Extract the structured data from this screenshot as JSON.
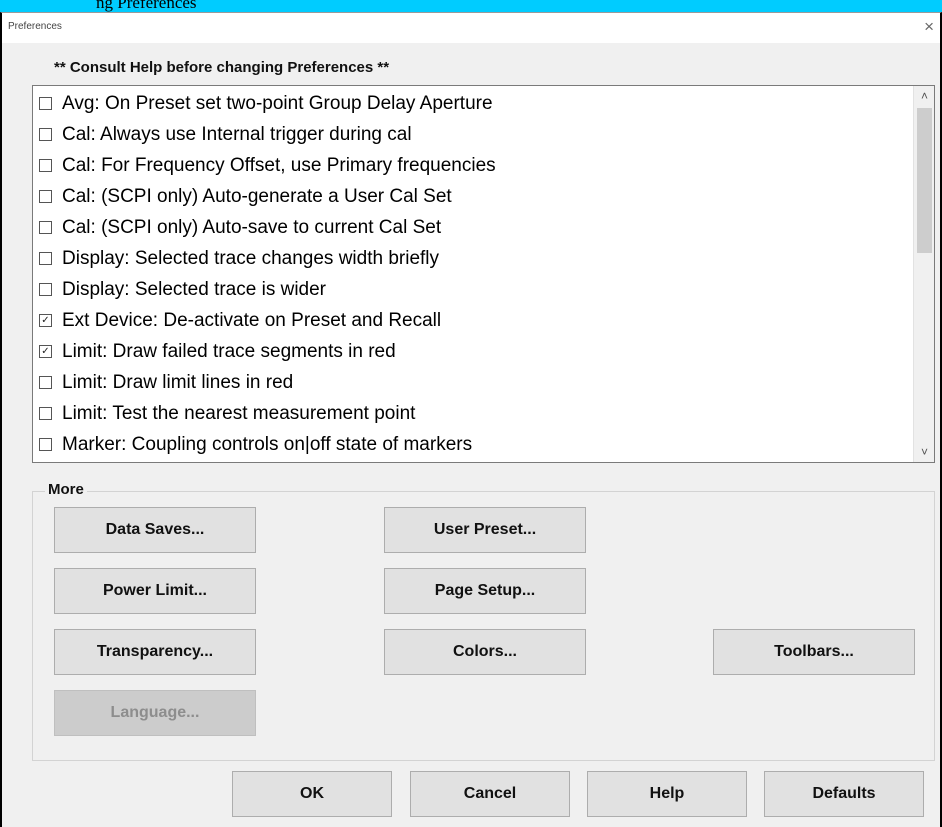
{
  "header": {
    "cut_text": "ng Preferences"
  },
  "dialog": {
    "title": "Preferences",
    "close": "×",
    "notice": "** Consult Help before changing Preferences **"
  },
  "preferences": {
    "items": [
      {
        "label": "Avg: On Preset set two-point Group Delay Aperture",
        "checked": false,
        "mark": ""
      },
      {
        "label": "Cal: Always use Internal trigger during cal",
        "checked": false,
        "mark": ""
      },
      {
        "label": "Cal: For Frequency Offset, use Primary frequencies",
        "checked": false,
        "mark": ""
      },
      {
        "label": "Cal: (SCPI only) Auto-generate a User Cal Set",
        "checked": false,
        "mark": ""
      },
      {
        "label": "Cal: (SCPI only) Auto-save to current Cal Set",
        "checked": false,
        "mark": ""
      },
      {
        "label": "Display: Selected trace changes width briefly",
        "checked": false,
        "mark": ""
      },
      {
        "label": "Display: Selected trace is wider",
        "checked": false,
        "mark": ""
      },
      {
        "label": "Ext Device: De-activate on Preset and Recall",
        "checked": true,
        "mark": "✓"
      },
      {
        "label": "Limit: Draw failed trace segments in red",
        "checked": true,
        "mark": "✓"
      },
      {
        "label": "Limit: Draw limit lines in red",
        "checked": false,
        "mark": ""
      },
      {
        "label": "Limit: Test the nearest measurement point",
        "checked": false,
        "mark": ""
      },
      {
        "label": "Marker: Coupling controls on|off state of markers",
        "checked": false,
        "mark": ""
      }
    ],
    "scroll_up": "˄",
    "scroll_down": "˅"
  },
  "more": {
    "legend": "More",
    "buttons": {
      "data_saves": "Data Saves...",
      "user_preset": "User Preset...",
      "power_limit": "Power Limit...",
      "page_setup": "Page Setup...",
      "transparency": "Transparency...",
      "colors": "Colors...",
      "toolbars": "Toolbars...",
      "language": "Language..."
    }
  },
  "footer": {
    "ok": "OK",
    "cancel": "Cancel",
    "help": "Help",
    "defaults": "Defaults"
  },
  "colors": {
    "top_band": "#00ccff",
    "dialog_bg": "#f0f0f0",
    "button_bg": "#e1e1e1",
    "disabled_button_bg": "#cccccc"
  }
}
